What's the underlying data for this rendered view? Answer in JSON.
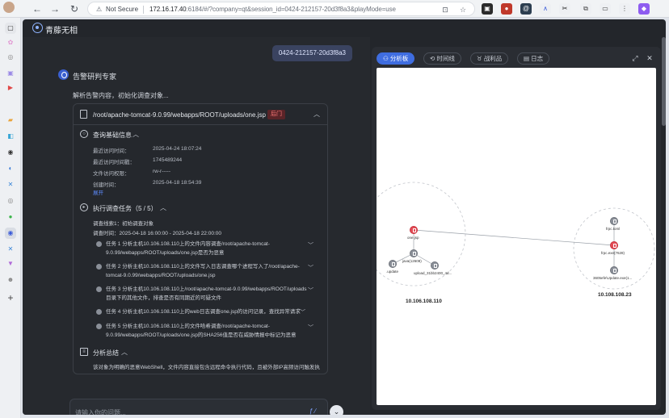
{
  "browser": {
    "security_label": "Not Secure",
    "url_host": "172.16.17.40",
    "url_rest": ":6184/#/?company=qt&session_id=0424-212157-20d3f8a3&playMode=use"
  },
  "app": {
    "title": "青藤无相"
  },
  "chat": {
    "session_id": "0424-212157-20d3f8a3",
    "agent_name": "告警研判专家",
    "intro": "解析告警内容，初始化调查对象...",
    "card": {
      "file_path": "/root/apache-tomcat-9.0.99/webapps/ROOT/uploads/one.jsp",
      "tag": "后门",
      "basic_info_title": "查询基础信息",
      "basic_info": [
        {
          "k": "最近访问时间：",
          "v": "2025-04-24 18:07:24"
        },
        {
          "k": "最近访问时间戳：",
          "v": "1745489244"
        },
        {
          "k": "文件访问权限：",
          "v": "rw-r-----"
        },
        {
          "k": "创建时间：",
          "v": "2025-04-18 18:54:39"
        }
      ],
      "expand_label": "展开",
      "tasks_title": "执行调查任务（5 / 5）",
      "clue": "调查线索1：初始调查对象",
      "time_range": "调查时间：2025-04-18 16:00:00 - 2025-04-18 22:00:00",
      "tasks": [
        "任务 1 分析主机10.106.108.110上的文件内容调查/root/apache-tomcat-9.0.99/webapps/ROOT/uploads/one.jsp是否为恶意",
        "任务 2 分析主机10.106.108.110上的文件写入日志调查哪个进程写入了/root/apache-tomcat-9.0.99/webapps/ROOT/uploads/one.jsp",
        "任务 3 分析主机10.106.108.110上/root/apache-tomcat-9.0.99/webapps/ROOT/uploads目录下的其他文件，排查是否有同期近的可疑文件",
        "任务 4 分析主机10.106.108.110上的web日志调查one.jsp的访问记录，查找异常请求",
        "任务 5 分析主机10.106.108.110上的文件哈希调查/root/apache-tomcat-9.0.99/webapps/ROOT/uploads/one.jsp的SHA256值是否在威胁情报中标记为恶意"
      ],
      "summary_title": "分析总结",
      "summary_text": "该对象为明确的恶意WebShell，文件内容直接包含远程命令执行代码，且被外部IP高频访问触发执"
    },
    "input_placeholder": "请输入你的问题..."
  },
  "panel": {
    "tabs": [
      "分析板",
      "时间线",
      "战利品",
      "日志"
    ],
    "active_tab": "分析板"
  },
  "graph": {
    "hosts": [
      {
        "ip": "10.106.108.110",
        "nodes": [
          {
            "label": "one.jsp",
            "kind": "file",
            "alert": true
          },
          {
            "label": "java(12608)",
            "kind": "process",
            "alert": false
          },
          {
            "label": ".update",
            "kind": "file",
            "alert": false
          },
          {
            "label": "upload_31bb2400_4d...",
            "kind": "file",
            "alert": false
          }
        ]
      },
      {
        "ip": "10.108.108.23",
        "nodes": [
          {
            "label": "frpc.toml",
            "kind": "file",
            "alert": false
          },
          {
            "label": "frpc.exe(7628)",
            "kind": "process",
            "alert": true
          },
          {
            "label": "3605efe\\Update.exe(1...",
            "kind": "process",
            "alert": false
          }
        ]
      }
    ]
  },
  "colors": {
    "accent": "#3f6de0",
    "alert_node": "#e44b55",
    "normal_node": "#8a8f98",
    "tag_red_text": "#ff7a7a"
  }
}
